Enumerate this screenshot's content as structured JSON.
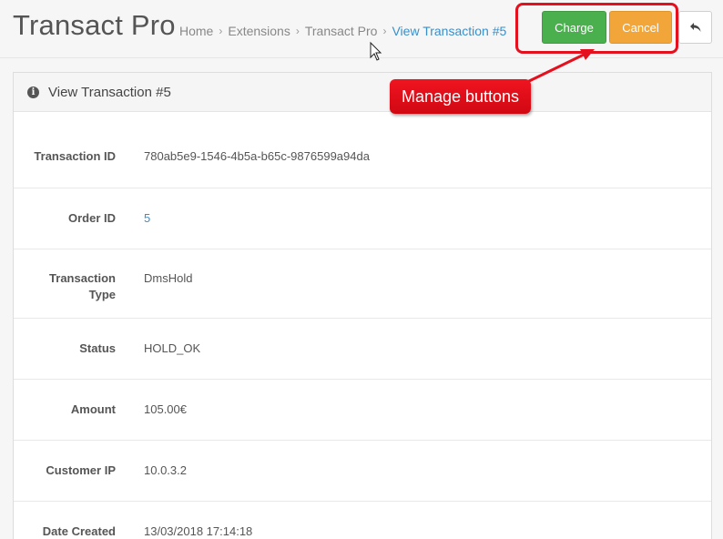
{
  "header": {
    "title": "Transact Pro",
    "breadcrumb": [
      "Home",
      "Extensions",
      "Transact Pro",
      "View Transaction #5"
    ],
    "separator": "›",
    "buttons": {
      "charge": "Charge",
      "cancel": "Cancel",
      "back_icon": "reply-icon"
    }
  },
  "panel": {
    "heading": "View Transaction #5",
    "heading_icon": "info-circle-icon",
    "rows": [
      {
        "label": "Transaction ID",
        "value": "780ab5e9-1546-4b5a-b65c-9876599a94da"
      },
      {
        "label": "Order ID",
        "value": "5"
      },
      {
        "label": "Transaction Type",
        "value": "DmsHold"
      },
      {
        "label": "Status",
        "value": "HOLD_OK"
      },
      {
        "label": "Amount",
        "value": "105.00€"
      },
      {
        "label": "Customer IP",
        "value": "10.0.3.2"
      },
      {
        "label": "Date Created",
        "value": "13/03/2018 17:14:18"
      }
    ]
  },
  "annotation": {
    "callout_text": "Manage buttons",
    "color": "#e4101e"
  },
  "colors": {
    "charge": "#4ab04e",
    "cancel": "#f2a63a",
    "link": "#3a8fc8"
  }
}
